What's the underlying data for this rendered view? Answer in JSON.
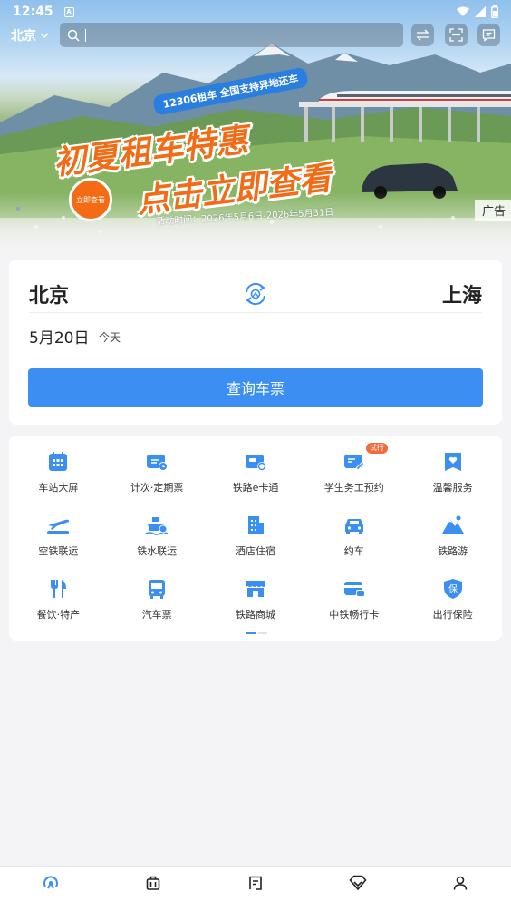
{
  "status_bar": {
    "time": "12:45",
    "app_icon": "A"
  },
  "top_bar": {
    "city": "北京",
    "search_placeholder": "",
    "icons": [
      "swap-arrows-icon",
      "scan-icon",
      "message-icon"
    ]
  },
  "banner": {
    "tag": "12306租车 全国支持异地还车",
    "line1": "初夏租车特惠",
    "line2": "点击立即查看",
    "date": "活动时间：2026年5月6日-2026年5月31日",
    "hand_text": "立即查看",
    "ad_label": "广告"
  },
  "ticket": {
    "from": "北京",
    "to": "上海",
    "date": "5月20日",
    "date_note": "今天",
    "query_label": "查询车票"
  },
  "services": [
    {
      "label": "车站大屏",
      "icon": "station-screen-icon"
    },
    {
      "label": "计次·定期票",
      "icon": "period-ticket-icon"
    },
    {
      "label": "铁路e卡通",
      "icon": "rail-ecard-icon"
    },
    {
      "label": "学生务工预约",
      "icon": "student-booking-icon",
      "badge": "试行"
    },
    {
      "label": "温馨服务",
      "icon": "care-service-icon"
    },
    {
      "label": "空铁联运",
      "icon": "air-rail-icon"
    },
    {
      "label": "铁水联运",
      "icon": "rail-ship-icon"
    },
    {
      "label": "酒店住宿",
      "icon": "hotel-icon"
    },
    {
      "label": "约车",
      "icon": "car-icon"
    },
    {
      "label": "铁路游",
      "icon": "mountain-icon"
    },
    {
      "label": "餐饮·特产",
      "icon": "dining-icon"
    },
    {
      "label": "汽车票",
      "icon": "bus-icon"
    },
    {
      "label": "铁路商城",
      "icon": "store-icon"
    },
    {
      "label": "中铁畅行卡",
      "icon": "rail-card-icon"
    },
    {
      "label": "出行保险",
      "icon": "insurance-icon"
    }
  ],
  "bottom_nav": [
    {
      "name": "home",
      "icon": "home-logo-icon",
      "active": true
    },
    {
      "name": "trips",
      "icon": "suitcase-icon"
    },
    {
      "name": "orders",
      "icon": "orders-icon"
    },
    {
      "name": "member",
      "icon": "diamond-icon"
    },
    {
      "name": "profile",
      "icon": "user-icon"
    }
  ],
  "colors": {
    "accent": "#3b8ff3",
    "promo": "#f36b14",
    "badge": "#f06a3a"
  }
}
